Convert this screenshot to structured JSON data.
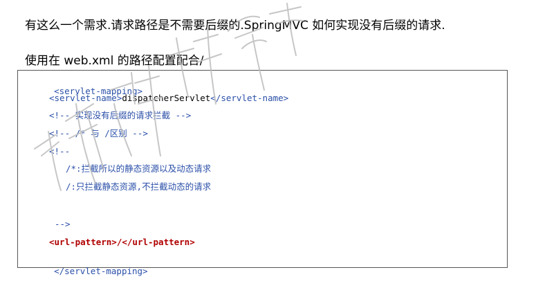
{
  "paragraphs": [
    "有这么一个需求.请求路径是不需要后缀的.SpringMVC 如何实现没有后缀的请求.",
    "使用在 web.xml 的路径配置配合/"
  ],
  "code": {
    "servlet_mapping_open": "<servlet-mapping>",
    "servlet_name_open": "<servlet-name>",
    "servlet_name_value": "dispatcherServlet",
    "servlet_name_close": "</servlet-name>",
    "comment_1": "<!-- 实现没有后缀的请求拦截 -->",
    "comment_2": "<!-- /* 与 /区别 -->",
    "comment_3_open": "<!--",
    "comment_3_line1": "/*:拦截所以的静态资源以及动态请求",
    "comment_3_line2": "/:只拦截静态资源,不拦截动态的请求",
    "comment_3_close": "-->",
    "url_pattern_open": "<url-pattern>",
    "url_pattern_value": "/",
    "url_pattern_close": "</url-pattern>",
    "servlet_mapping_close": "</servlet-mapping>"
  },
  "colors": {
    "tag": "#2a4fa8",
    "text": "#000000",
    "highlight": "#b00000",
    "border": "#555555"
  }
}
